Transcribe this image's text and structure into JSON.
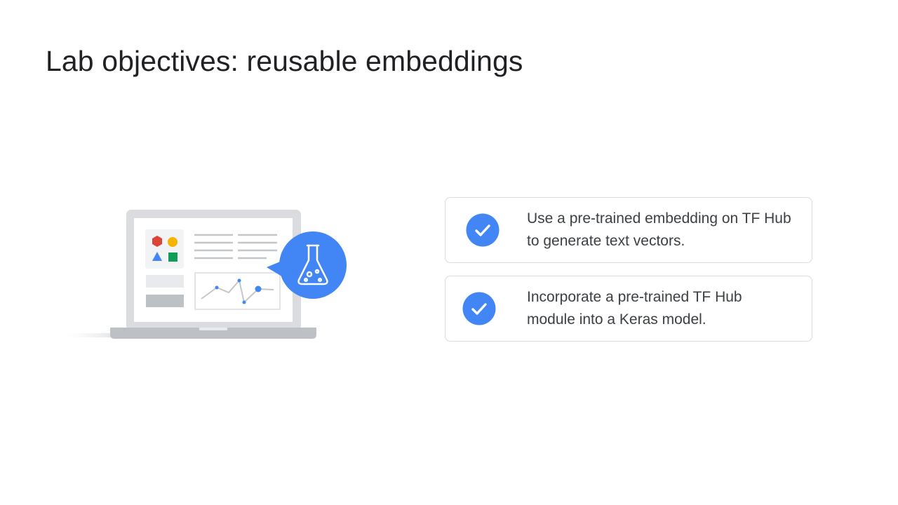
{
  "slide": {
    "title": "Lab objectives: reusable embeddings"
  },
  "illustration": {
    "laptop_icon": "laptop-icon",
    "lab_icon": "flask-icon",
    "accent_color": "#4285f4"
  },
  "objectives": [
    {
      "icon": "checkmark-icon",
      "text": "Use a pre-trained embedding on TF Hub to generate text vectors."
    },
    {
      "icon": "checkmark-icon",
      "text": "Incorporate a pre-trained TF Hub module into a Keras model."
    }
  ],
  "colors": {
    "check_blue": "#4285f4",
    "card_border": "#dadce0",
    "red": "#db4437",
    "yellow": "#f4b400",
    "green": "#0f9d58"
  }
}
